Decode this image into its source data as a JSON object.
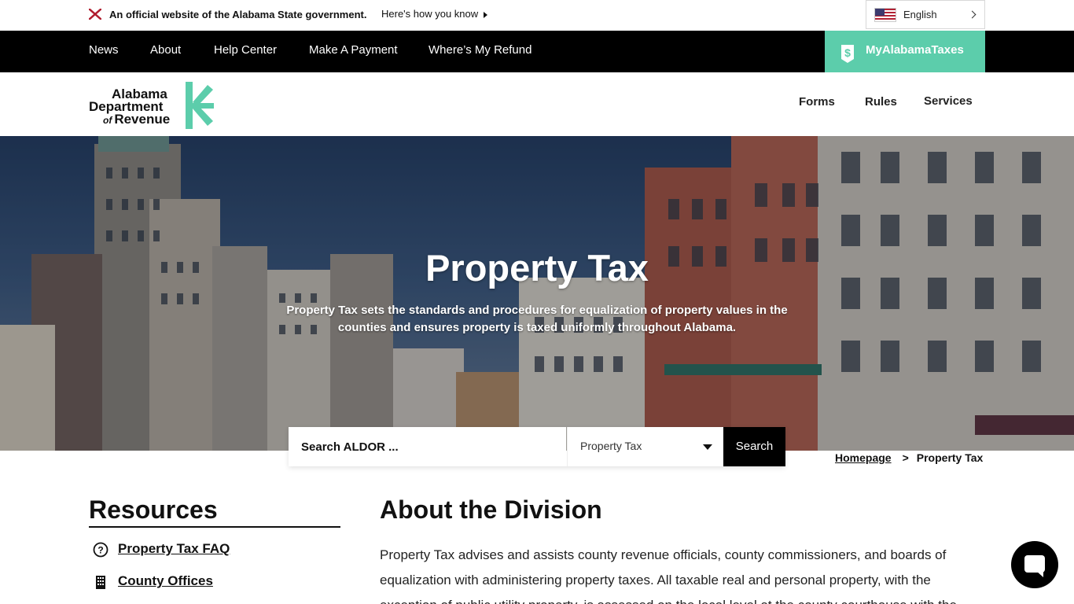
{
  "banner": {
    "official_text": "An official website of the Alabama State government.",
    "how_text": "Here's how you know",
    "language": "English"
  },
  "topnav": {
    "items": [
      {
        "label": "News"
      },
      {
        "label": "About"
      },
      {
        "label": "Help Center"
      },
      {
        "label": "Make A Payment"
      },
      {
        "label": "Where’s My Refund"
      }
    ],
    "my_taxes_label": "MyAlabamaTaxes"
  },
  "logo": {
    "line1": "Alabama",
    "line2": "Department",
    "line3_small": "of",
    "line3": "Revenue",
    "accent_color": "#5ccdab"
  },
  "header_nav": {
    "items": [
      {
        "label": "Forms"
      },
      {
        "label": "Rules"
      },
      {
        "label": "Services"
      }
    ]
  },
  "hero": {
    "title": "Property Tax",
    "subtitle": "Property Tax sets the standards and procedures for equalization of property values in the counties and ensures property is taxed uniformly throughout Alabama."
  },
  "search": {
    "placeholder": "Search ALDOR ...",
    "scope_value": "Property Tax",
    "button_label": "Search"
  },
  "breadcrumb": {
    "home": "Homepage",
    "separator": ">",
    "current": "Property Tax"
  },
  "resources": {
    "title": "Resources",
    "items": [
      {
        "label": "Property Tax FAQ",
        "icon": "question-circle-icon"
      },
      {
        "label": "County Offices",
        "icon": "building-icon"
      }
    ]
  },
  "about": {
    "title": "About the Division",
    "body": "Property Tax advises and assists county revenue officials, county commissioners, and boards of equalization with administering property taxes.  All taxable real and personal property, with the exception of public utility property, is assessed on the local level at the county courthouse with the"
  },
  "colors": {
    "brand_green": "#5ccdab",
    "nav_black": "#000000"
  }
}
